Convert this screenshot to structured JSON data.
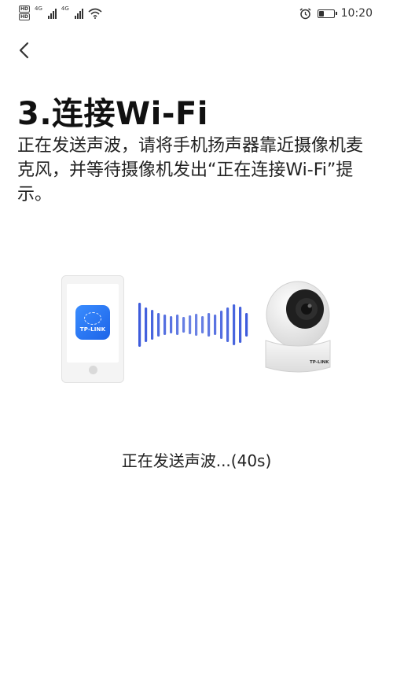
{
  "statusbar": {
    "hd1": "HD",
    "hd2": "HD",
    "net1": "4G",
    "net2": "4G",
    "battery_level": 0.35,
    "time": "10:20"
  },
  "nav": {
    "back_icon": "chevron-left-icon"
  },
  "page": {
    "title": "3.连接Wi-Fi",
    "description": "正在发送声波，请将手机扬声器靠近摄像机麦克风，并等待摄像机发出“正在连接Wi-Fi”提示。"
  },
  "illustration": {
    "app_label": "TP-LINK",
    "camera_label": "TP-LINK",
    "wave_color": "#3d5bdc"
  },
  "progress": {
    "text": "正在发送声波...(40s)"
  }
}
